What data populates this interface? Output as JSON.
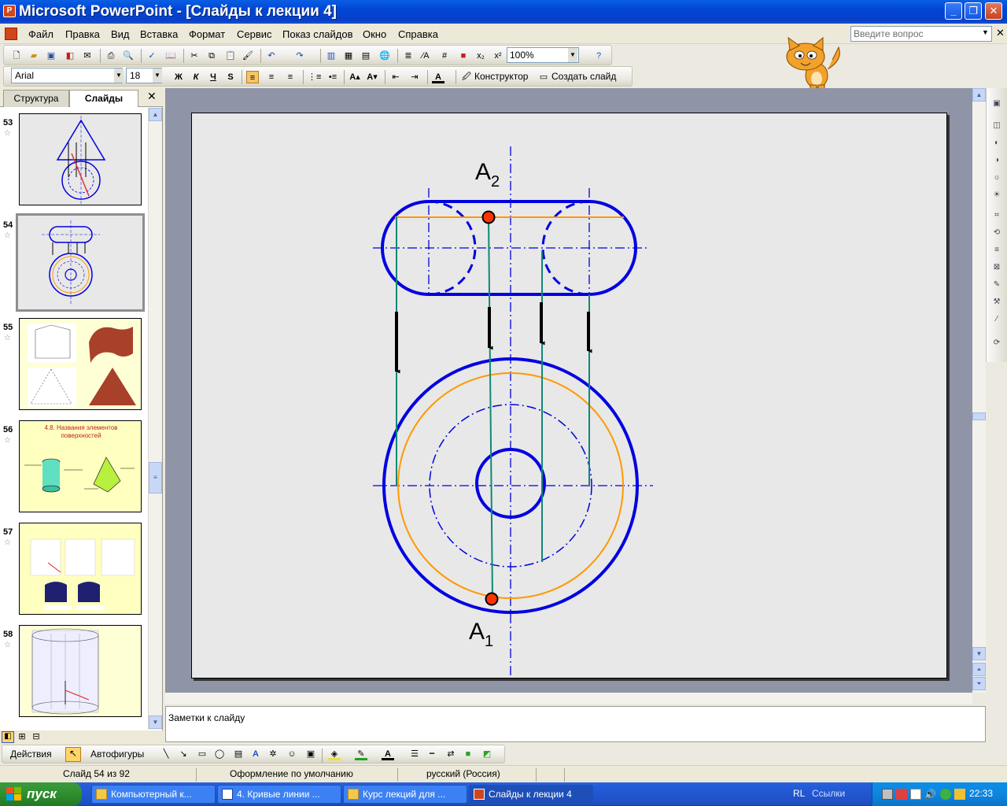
{
  "window": {
    "title": "Microsoft PowerPoint - [Слайды к лекции 4]",
    "min_glyph": "_",
    "max_glyph": "❐",
    "close_glyph": "✕"
  },
  "menu": {
    "items": [
      "Файл",
      "Правка",
      "Вид",
      "Вставка",
      "Формат",
      "Сервис",
      "Показ слайдов",
      "Окно",
      "Справка"
    ],
    "ask_placeholder": "Введите вопрос",
    "close_glyph": "✕"
  },
  "toolbar_standard": {
    "zoom": "100%"
  },
  "toolbar_format": {
    "font": "Arial",
    "size": "18",
    "bold": "Ж",
    "italic": "К",
    "underline": "Ч",
    "shadow": "S",
    "designer": "Конструктор",
    "new_slide": "Создать слайд"
  },
  "left_pane": {
    "tab_outline": "Структура",
    "tab_slides": "Слайды",
    "close_glyph": "✕",
    "slides": [
      {
        "num": "53",
        "star": "☆"
      },
      {
        "num": "54",
        "star": "☆"
      },
      {
        "num": "55",
        "star": "☆"
      },
      {
        "num": "56",
        "star": "☆",
        "caption": "4.8. Названия элементов поверхностей"
      },
      {
        "num": "57",
        "star": "☆"
      },
      {
        "num": "58",
        "star": "☆"
      }
    ]
  },
  "slide": {
    "label_top": "A",
    "label_top_sub": "2",
    "label_bottom": "A",
    "label_bottom_sub": "1",
    "colors": {
      "outline": "#0000e0",
      "orange": "#ff9900",
      "teal": "#108878",
      "point": "#ff3300"
    }
  },
  "notes": {
    "placeholder": "Заметки к слайду"
  },
  "draw_toolbar": {
    "actions": "Действия",
    "autoshapes": "Автофигуры"
  },
  "status": {
    "slide_pos": "Слайд 54 из 92",
    "design": "Оформление по умолчанию",
    "language": "русский (Россия)"
  },
  "taskbar": {
    "start": "пуск",
    "tasks": [
      "Компьютерный к...",
      "4. Кривые линии ...",
      "Курс лекций для ...",
      "Слайды к лекции 4"
    ],
    "lang": "RL",
    "links": "Ссылки",
    "clock": "22:33"
  }
}
